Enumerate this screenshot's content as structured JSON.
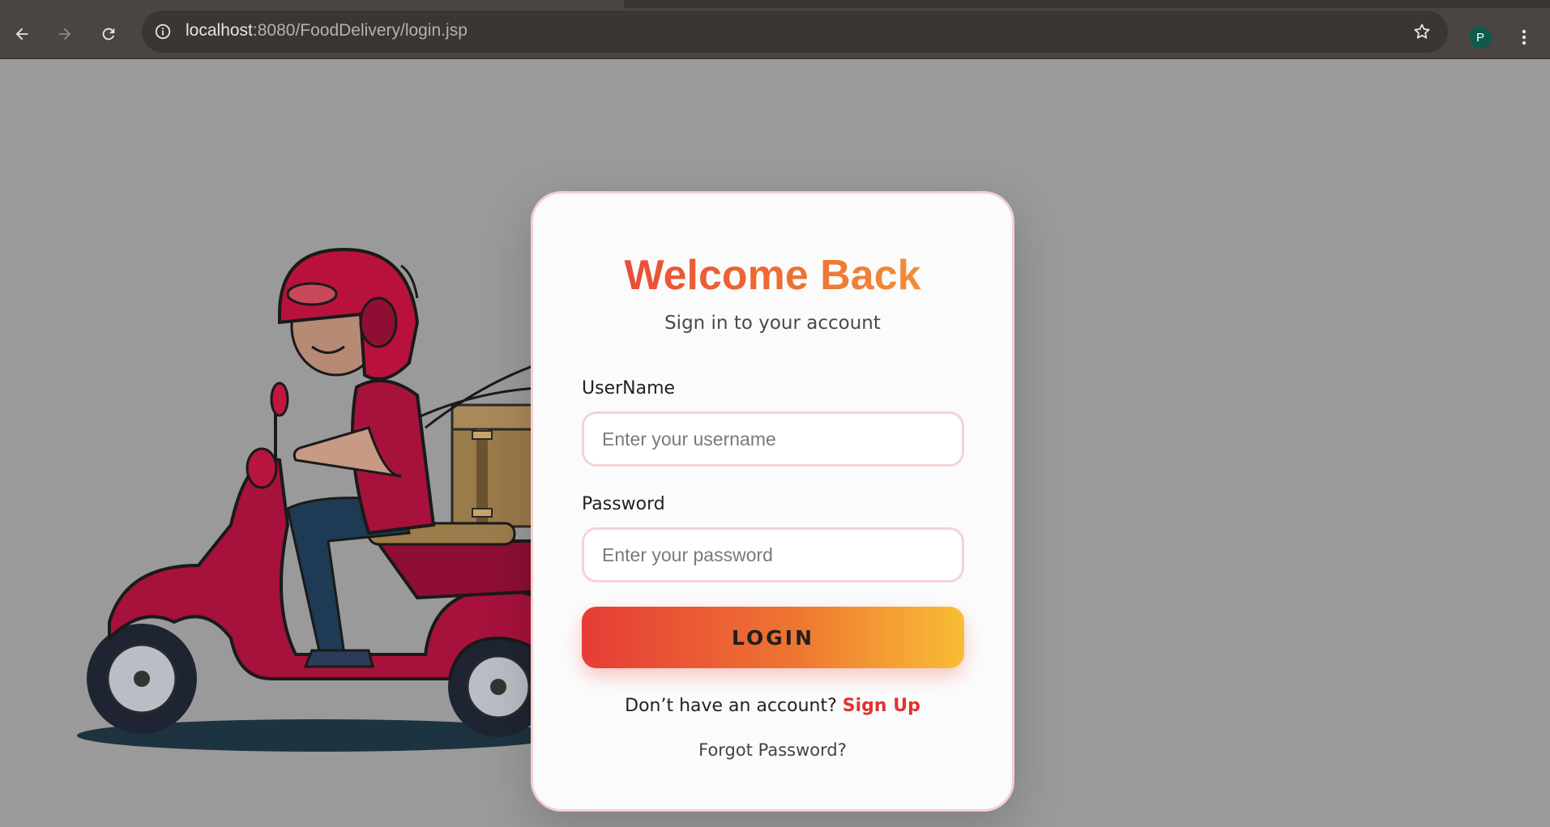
{
  "browser": {
    "url_host": "localhost",
    "url_rest": ":8080/FoodDelivery/login.jsp",
    "profile_initial": "P",
    "icons": {
      "back": "back-arrow-icon",
      "forward": "forward-arrow-icon",
      "reload": "reload-icon",
      "site_info": "info-icon",
      "bookmark": "star-icon",
      "menu": "more-vertical-icon"
    }
  },
  "login": {
    "title": "Welcome Back",
    "subtitle": "Sign in to your account",
    "username_label": "UserName",
    "username_placeholder": "Enter your username",
    "username_value": "",
    "password_label": "Password",
    "password_placeholder": "Enter your password",
    "password_value": "",
    "login_button": "LOGIN",
    "signup_prompt": "Don’t have an account?",
    "signup_link": "Sign Up",
    "forgot_password": "Forgot Password?"
  },
  "colors": {
    "accent_red": "#e63b3b",
    "accent_orange": "#ee7432",
    "accent_yellow": "#f8be34",
    "card_border": "#f5cfd0",
    "page_background": "#9a9a9a"
  },
  "illustration": "delivery-scooter-illustration"
}
